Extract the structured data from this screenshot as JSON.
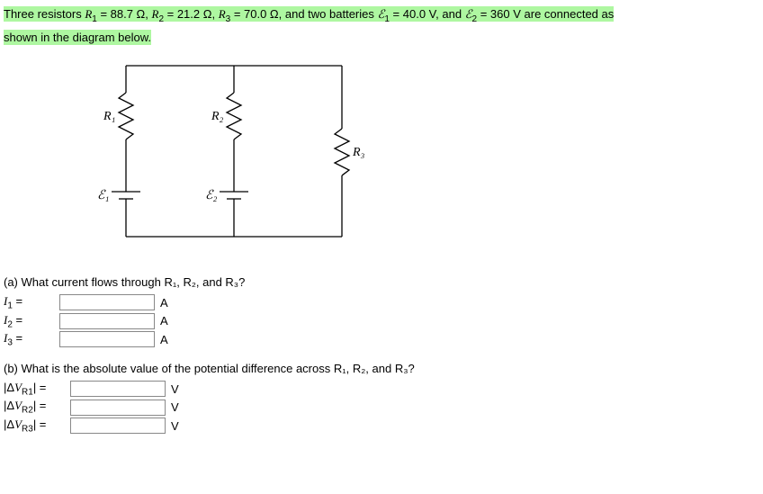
{
  "intro": {
    "pre": "Three resistors ",
    "r1_name": "R",
    "r1_sub": "1",
    "r1_eq": " = 88.7 Ω, ",
    "r2_name": "R",
    "r2_sub": "2",
    "r2_eq": " = 21.2 Ω, ",
    "r3_name": "R",
    "r3_sub": "3",
    "r3_eq": " = 70.0 Ω, and two batteries ",
    "e1_name": "ℰ",
    "e1_sub": "1",
    "e1_eq": " = 40.0 V, and ",
    "e2_name": "ℰ",
    "e2_sub": "2",
    "e2_eq": " = 360 V are connected as",
    "line2": "shown in the diagram below."
  },
  "diagram": {
    "R1": "R₁",
    "R2": "R₂",
    "R3": "R₃",
    "E1": "ℰ₁",
    "E2": "ℰ₂"
  },
  "partA": {
    "prompt": "(a) What current flows through R₁, R₂, and R₃?",
    "rows": [
      {
        "label_sym": "I",
        "label_sub": "1",
        "eq": " = ",
        "unit": "A"
      },
      {
        "label_sym": "I",
        "label_sub": "2",
        "eq": " = ",
        "unit": "A"
      },
      {
        "label_sym": "I",
        "label_sub": "3",
        "eq": " = ",
        "unit": "A"
      }
    ]
  },
  "partB": {
    "prompt": "(b) What is the absolute value of the potential difference across R₁, R₂, and R₃?",
    "rows": [
      {
        "label_pre": "|Δ",
        "label_sym": "V",
        "label_sub": "R1",
        "label_post": "| = ",
        "unit": "V"
      },
      {
        "label_pre": "|Δ",
        "label_sym": "V",
        "label_sub": "R2",
        "label_post": "| = ",
        "unit": "V"
      },
      {
        "label_pre": "|Δ",
        "label_sym": "V",
        "label_sub": "R3",
        "label_post": "| = ",
        "unit": "V"
      }
    ]
  }
}
